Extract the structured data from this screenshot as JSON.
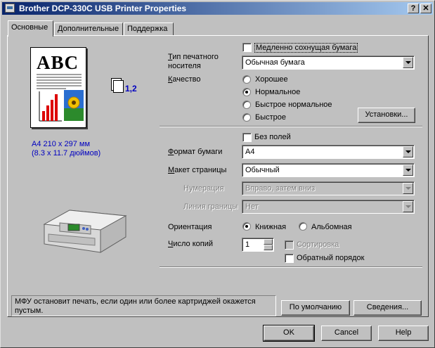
{
  "window": {
    "title": "Brother DCP-330C USB Printer Properties",
    "help_btn": "?",
    "close_btn": "✕"
  },
  "tabs": [
    {
      "label": "Основные",
      "active": true
    },
    {
      "label": "Дополнительные",
      "active": false
    },
    {
      "label": "Поддержка",
      "active": false
    }
  ],
  "preview": {
    "abc": "ABC",
    "paper_size": "A4 210 x 297 мм",
    "paper_size_in": "(8.3 x 11.7 дюймов)",
    "copies_icon_text": "1,2"
  },
  "media": {
    "slow_dry_label": "Медленно сохнущая бумага",
    "slow_dry_checked": false,
    "type_label": "Тип печатного носителя",
    "type_value": "Обычная бумага"
  },
  "quality": {
    "label": "Качество",
    "options": [
      "Хорошее",
      "Нормальное",
      "Быстрое нормальное",
      "Быстрое"
    ],
    "selected": "Нормальное",
    "settings_button": "Установки..."
  },
  "layout": {
    "borderless_label": "Без полей",
    "borderless_checked": false,
    "paper_size_label": "Формат бумаги",
    "paper_size_value": "A4",
    "page_layout_label": "Макет страницы",
    "page_layout_value": "Обычный",
    "numbering_label": "Нумерация",
    "numbering_value": "Вправо, затем вниз",
    "border_line_label": "Линия границы",
    "border_line_value": "Нет"
  },
  "orientation": {
    "label": "Ориентация",
    "portrait": "Книжная",
    "landscape": "Альбомная",
    "selected": "Книжная"
  },
  "copies": {
    "label": "Число копий",
    "value": "1",
    "collate_label": "Сортировка",
    "reverse_label": "Обратный порядок",
    "reverse_checked": false
  },
  "status": {
    "message": "МФУ остановит печать, если один или более картриджей окажется пустым."
  },
  "buttons": {
    "default": "По умолчанию",
    "info": "Сведения...",
    "ok": "OK",
    "cancel": "Cancel",
    "help": "Help"
  }
}
